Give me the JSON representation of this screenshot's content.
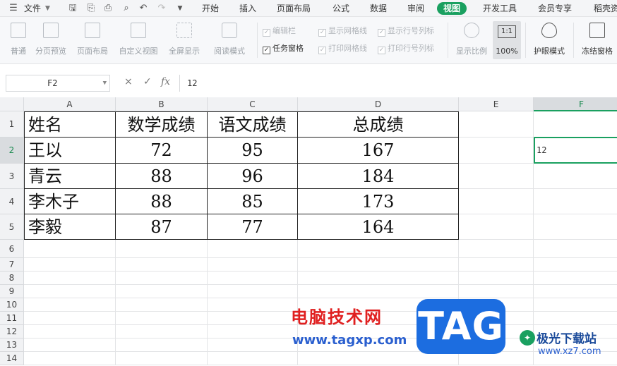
{
  "topbar": {
    "file_menu": "文件",
    "tabs": [
      "开始",
      "插入",
      "页面布局",
      "公式",
      "数据",
      "审阅",
      "视图",
      "开发工具",
      "会员专享",
      "稻壳资"
    ],
    "active_tab": "视图"
  },
  "ribbon": {
    "view_buttons": [
      "普通",
      "分页预览",
      "页面布局",
      "自定义视图",
      "全屏显示",
      "阅读模式"
    ],
    "checkboxes": [
      {
        "label": "编辑栏",
        "checked": true,
        "enabled": false
      },
      {
        "label": "显示网格线",
        "checked": true,
        "enabled": false
      },
      {
        "label": "显示行号列标",
        "checked": true,
        "enabled": false
      },
      {
        "label": "任务窗格",
        "checked": true,
        "enabled": true
      },
      {
        "label": "打印网格线",
        "checked": true,
        "enabled": false
      },
      {
        "label": "打印行号列标",
        "checked": true,
        "enabled": false
      }
    ],
    "zoom_buttons": [
      "显示比例",
      "100%"
    ],
    "zoom_box": "1:1",
    "eye_mode": "护眼模式",
    "freeze": "冻结窗格"
  },
  "formula_bar": {
    "name_box": "F2",
    "formula_value": "12",
    "cancel_icon": "×",
    "confirm_icon": "✓",
    "fx_label": "fx"
  },
  "sheet": {
    "columns": [
      "A",
      "B",
      "C",
      "D",
      "E",
      "F"
    ],
    "selected_column": "F",
    "rows": [
      "1",
      "2",
      "3",
      "4",
      "5",
      "6",
      "7",
      "8",
      "9",
      "10",
      "11",
      "12",
      "13",
      "14"
    ],
    "selected_row": "2",
    "table": {
      "headers": [
        "姓名",
        "数学成绩",
        "语文成绩",
        "总成绩"
      ],
      "data": [
        [
          "王以",
          "72",
          "95",
          "167"
        ],
        [
          "青云",
          "88",
          "96",
          "184"
        ],
        [
          "李木子",
          "88",
          "85",
          "173"
        ],
        [
          "李毅",
          "87",
          "77",
          "164"
        ]
      ]
    },
    "selected_cell_value": "12"
  },
  "watermark": {
    "cn_title": "电脑技术网",
    "tag": "TAG",
    "url": "www.tagxp.com",
    "site_cn": "极光下载站",
    "site_url": "www.xz7.com"
  },
  "colors": {
    "accent": "#1aa060",
    "watermark_red": "#e02020",
    "watermark_blue": "#1c6de0"
  }
}
